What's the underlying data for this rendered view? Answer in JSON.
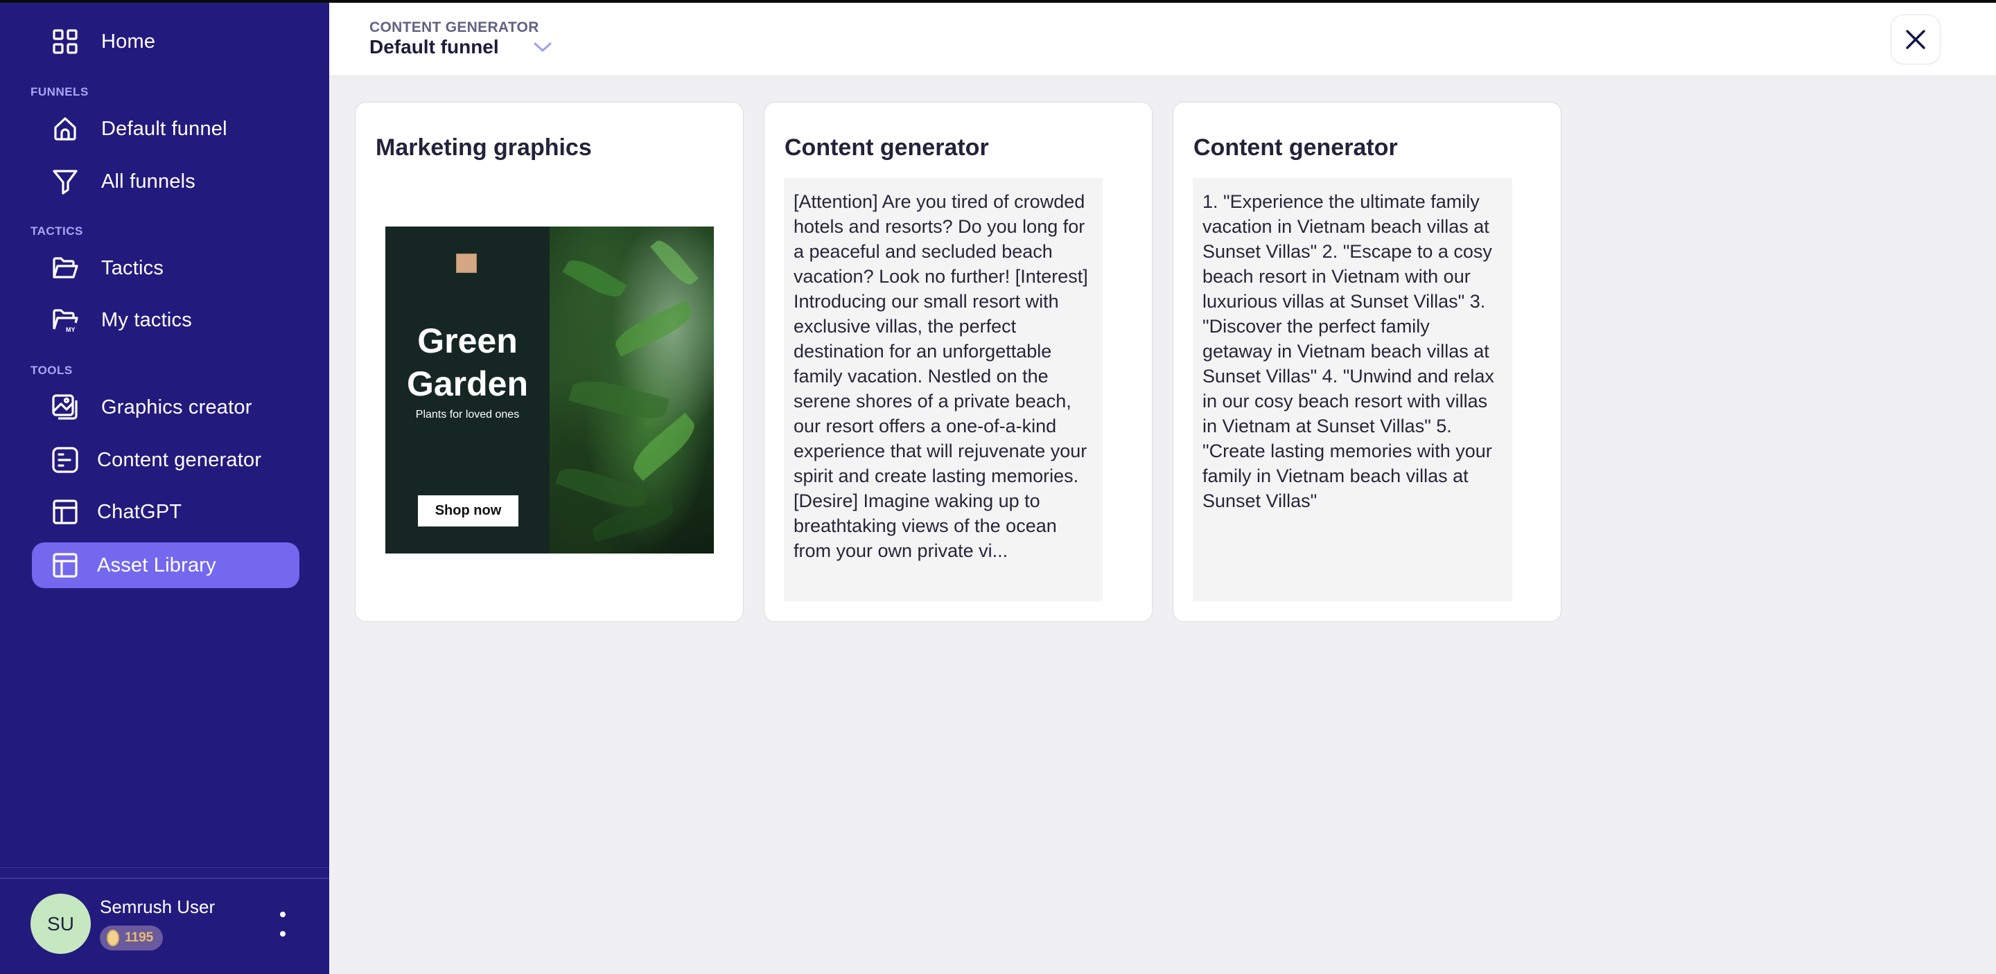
{
  "sidebar": {
    "home": {
      "label": "Home",
      "icon": "grid-icon"
    },
    "sections": [
      {
        "label": "FUNNELS"
      },
      {
        "label": "TACTICS"
      },
      {
        "label": "TOOLS"
      }
    ],
    "funnels": [
      {
        "label": "Default funnel",
        "icon": "house-icon"
      },
      {
        "label": "All funnels",
        "icon": "filter-icon"
      }
    ],
    "tactics": [
      {
        "label": "Tactics",
        "icon": "folder-open-icon"
      },
      {
        "label": "My tactics",
        "icon": "folder-my-icon"
      }
    ],
    "tools": [
      {
        "label": "Graphics creator",
        "icon": "images-icon"
      },
      {
        "label": "Content generator",
        "icon": "document-lines-icon"
      },
      {
        "label": "ChatGPT",
        "icon": "layout-icon"
      },
      {
        "label": "Asset Library",
        "icon": "layout-icon",
        "active": true
      }
    ],
    "user": {
      "initials": "SU",
      "name": "Semrush User",
      "credits": "1195"
    }
  },
  "header": {
    "breadcrumb": "CONTENT GENERATOR",
    "funnel_selected": "Default funnel"
  },
  "cards": [
    {
      "title": "Marketing graphics",
      "graphic": {
        "headline_line1": "Green",
        "headline_line2": "Garden",
        "subtitle": "Plants for loved ones",
        "button": "Shop now"
      }
    },
    {
      "title": "Content generator",
      "text": "[Attention] Are you tired of crowded hotels and resorts? Do you long for a peaceful and secluded beach vacation? Look no further! [Interest] Introducing our small resort with exclusive villas, the perfect destination for an unforgettable family vacation. Nestled on the serene shores of a private beach, our resort offers a one-of-a-kind experience that will rejuvenate your spirit and create lasting memories. [Desire] Imagine waking up to breathtaking views of the ocean from your own private vi..."
    },
    {
      "title": "Content generator",
      "text": "1. \"Experience the ultimate family vacation in Vietnam beach villas at Sunset Villas\" 2. \"Escape to a cosy beach resort in Vietnam with our luxurious villas at Sunset Villas\" 3. \"Discover the perfect family getaway in Vietnam beach villas at Sunset Villas\" 4. \"Unwind and relax in our cosy beach resort with villas in Vietnam at Sunset Villas\" 5. \"Create lasting memories with your family in Vietnam beach villas at Sunset Villas\""
    }
  ],
  "colors": {
    "sidebar_bg": "#231a7e",
    "active_item": "#7468ef",
    "section_label": "#a9a7f3",
    "avatar_bg": "#c6e8c0",
    "credits_text": "#e8bc6e",
    "page_bg": "#f0f0f3"
  }
}
